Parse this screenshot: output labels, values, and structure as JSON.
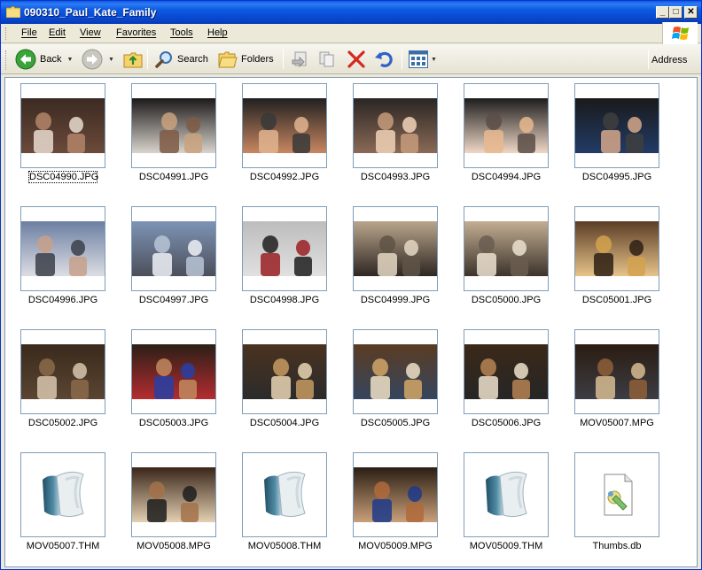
{
  "window": {
    "title": "090310_Paul_Kate_Family",
    "minimize_label": "_",
    "maximize_label": "□",
    "close_label": "✕"
  },
  "menu": [
    "File",
    "Edit",
    "View",
    "Favorites",
    "Tools",
    "Help"
  ],
  "toolbar": {
    "back_label": "Back",
    "search_label": "Search",
    "folders_label": "Folders",
    "address_label": "Address"
  },
  "files": [
    {
      "name": "DSC04990.JPG",
      "kind": "photo",
      "palette": [
        "#3b2a22",
        "#b3856a",
        "#e8dccf",
        "#6b4a3a"
      ],
      "focused": true
    },
    {
      "name": "DSC04991.JPG",
      "kind": "photo",
      "palette": [
        "#1c1a1a",
        "#c9a27e",
        "#7f5a44",
        "#d9d4cc"
      ]
    },
    {
      "name": "DSC04992.JPG",
      "kind": "photo",
      "palette": [
        "#202020",
        "#383838",
        "#e2b48f",
        "#c98761"
      ]
    },
    {
      "name": "DSC04993.JPG",
      "kind": "photo",
      "palette": [
        "#2a2624",
        "#c79b7b",
        "#f1d2b7",
        "#8a6a56"
      ]
    },
    {
      "name": "DSC04994.JPG",
      "kind": "photo",
      "palette": [
        "#1e1e1e",
        "#5a4d46",
        "#e7b98e",
        "#f0d8c6"
      ]
    },
    {
      "name": "DSC04995.JPG",
      "kind": "photo",
      "palette": [
        "#1a1a1a",
        "#3e3e3e",
        "#d6a789",
        "#223b66"
      ]
    },
    {
      "name": "DSC04996.JPG",
      "kind": "photo",
      "palette": [
        "#6c7fa2",
        "#c7a08a",
        "#3b3f4a",
        "#dcdde3"
      ]
    },
    {
      "name": "DSC04997.JPG",
      "kind": "photo",
      "palette": [
        "#7d94b6",
        "#b9c4d6",
        "#eef1f6",
        "#4c4f5a"
      ]
    },
    {
      "name": "DSC04998.JPG",
      "kind": "photo",
      "palette": [
        "#bdbdbd",
        "#1e1e1e",
        "#9a1e22",
        "#e0e0e0"
      ]
    },
    {
      "name": "DSC04999.JPG",
      "kind": "photo",
      "palette": [
        "#b9a58c",
        "#5f5347",
        "#e4d7c3",
        "#2e2722"
      ]
    },
    {
      "name": "DSC05000.JPG",
      "kind": "photo",
      "palette": [
        "#c3ae92",
        "#6a5d50",
        "#ece1cf",
        "#3c332b"
      ]
    },
    {
      "name": "DSC05001.JPG",
      "kind": "photo",
      "palette": [
        "#5b3d25",
        "#d3a24e",
        "#2e2014",
        "#e6c38a"
      ]
    },
    {
      "name": "DSC05002.JPG",
      "kind": "photo",
      "palette": [
        "#3a2a1c",
        "#8b6a4a",
        "#d8c6ae",
        "#5a4532"
      ]
    },
    {
      "name": "DSC05003.JPG",
      "kind": "photo",
      "palette": [
        "#2b1f16",
        "#c18a5e",
        "#2740a6",
        "#b42c30"
      ]
    },
    {
      "name": "DSC05004.JPG",
      "kind": "photo",
      "palette": [
        "#4a3220",
        "#c79a62",
        "#e9d5b5",
        "#2b2b2b"
      ]
    },
    {
      "name": "DSC05005.JPG",
      "kind": "photo",
      "palette": [
        "#5a3c22",
        "#d2a666",
        "#efe0c6",
        "#35455e"
      ]
    },
    {
      "name": "DSC05006.JPG",
      "kind": "photo",
      "palette": [
        "#3b2818",
        "#b68454",
        "#eee2cc",
        "#262626"
      ]
    },
    {
      "name": "MOV05007.MPG",
      "kind": "photo",
      "palette": [
        "#2a1c12",
        "#8f5f38",
        "#d7bc93",
        "#3d3d44"
      ]
    },
    {
      "name": "MOV05007.THM",
      "kind": "thm"
    },
    {
      "name": "MOV05008.MPG",
      "kind": "photo",
      "palette": [
        "#3a261a",
        "#a3724a",
        "#1d1d1d",
        "#e3cfb1"
      ]
    },
    {
      "name": "MOV05008.THM",
      "kind": "thm"
    },
    {
      "name": "MOV05009.MPG",
      "kind": "photo",
      "palette": [
        "#2b1e14",
        "#b06a3b",
        "#1f3a8a",
        "#c9a07a"
      ]
    },
    {
      "name": "MOV05009.THM",
      "kind": "thm"
    },
    {
      "name": "Thumbs.db",
      "kind": "db"
    }
  ]
}
